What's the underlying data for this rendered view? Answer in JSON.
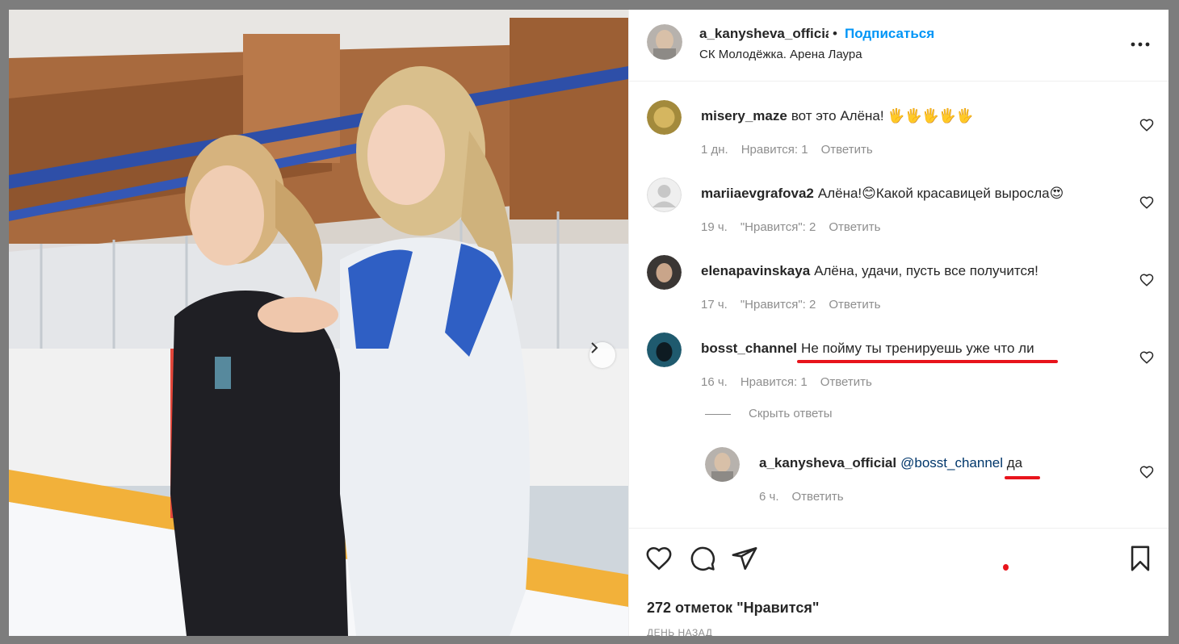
{
  "post": {
    "username": "a_kanysheva_official",
    "separator": "•",
    "follow_label": "Подписаться",
    "location": "СК Молодёжка. Арена Лаура",
    "more_icon": "more-horizontal-icon"
  },
  "comments": [
    {
      "user": "misery_maze",
      "text": "вот это Алёна! 🖐🖐🖐🖐🖐",
      "time": "1 дн.",
      "likes": "Нравится: 1",
      "reply": "Ответить"
    },
    {
      "user": "mariiaevgrafova2",
      "text": "Алёна!😊Какой красавицей выросла😍",
      "time": "19 ч.",
      "likes": "\"Нравится\": 2",
      "reply": "Ответить"
    },
    {
      "user": "elenapavinskaya",
      "text": "Алёна, удачи, пусть все получится!",
      "time": "17 ч.",
      "likes": "\"Нравится\": 2",
      "reply": "Ответить"
    },
    {
      "user": "bosst_channel",
      "text": "Не пойму ты тренируешь уже что ли",
      "time": "16 ч.",
      "likes": "Нравится: 1",
      "reply": "Ответить"
    }
  ],
  "hide_replies": "Скрыть ответы",
  "reply_comment": {
    "user": "a_kanysheva_official",
    "mention": "@bosst_channel",
    "text": "да",
    "time": "6 ч.",
    "reply": "Ответить"
  },
  "actions": {
    "likes_count": "272 отметок \"Нравится\"",
    "date": "ДЕНЬ НАЗАД"
  },
  "colors": {
    "accent": "#0095f6",
    "annotation_red": "#e8141c",
    "secondary_text": "#8e8e8e"
  }
}
